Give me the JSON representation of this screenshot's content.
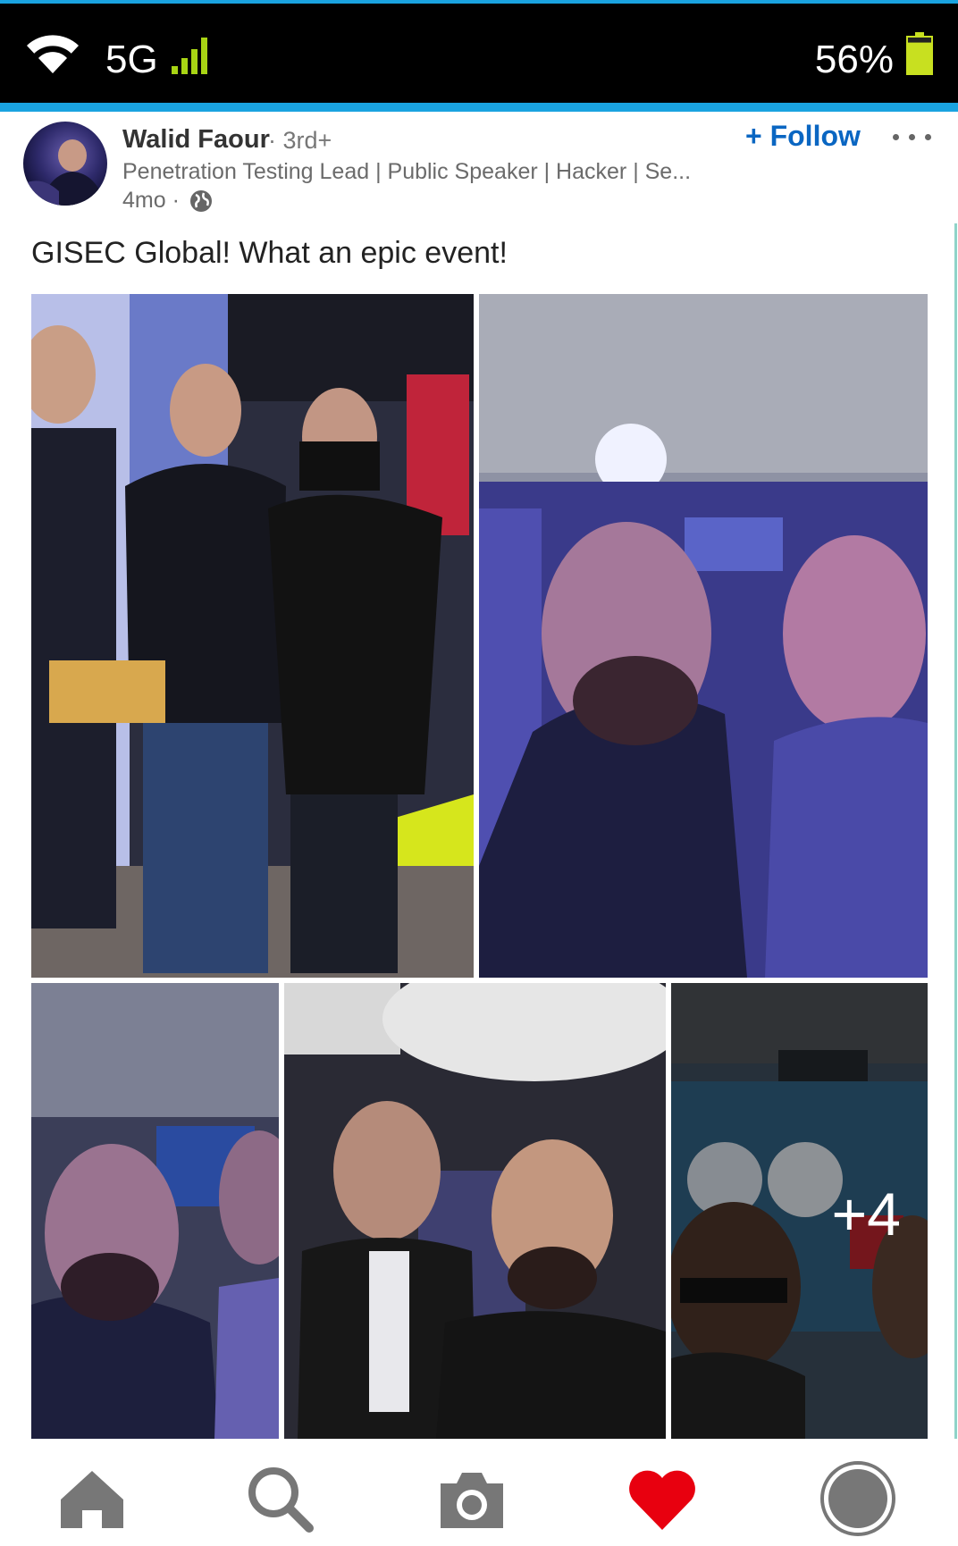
{
  "status_bar": {
    "network": "5G",
    "battery_percent": "56%",
    "icons": [
      "wifi-icon",
      "signal-icon",
      "battery-icon"
    ],
    "battery_level": 0.56,
    "accent_color": "#1aa3e0"
  },
  "post": {
    "author": {
      "name": "Walid Faour",
      "degree": "· 3rd+",
      "headline": "Penetration Testing Lead | Public Speaker | Hacker | Se...",
      "age": "4mo ·"
    },
    "follow_label": "+ Follow",
    "text": "GISEC Global! What an epic event!",
    "photos": {
      "count_shown": 5,
      "more_count_label": "+4"
    }
  },
  "bottom_nav": {
    "items": [
      "home-icon",
      "search-icon",
      "camera-icon",
      "heart-icon",
      "profile-icon"
    ],
    "active_color": "#e8000f"
  }
}
